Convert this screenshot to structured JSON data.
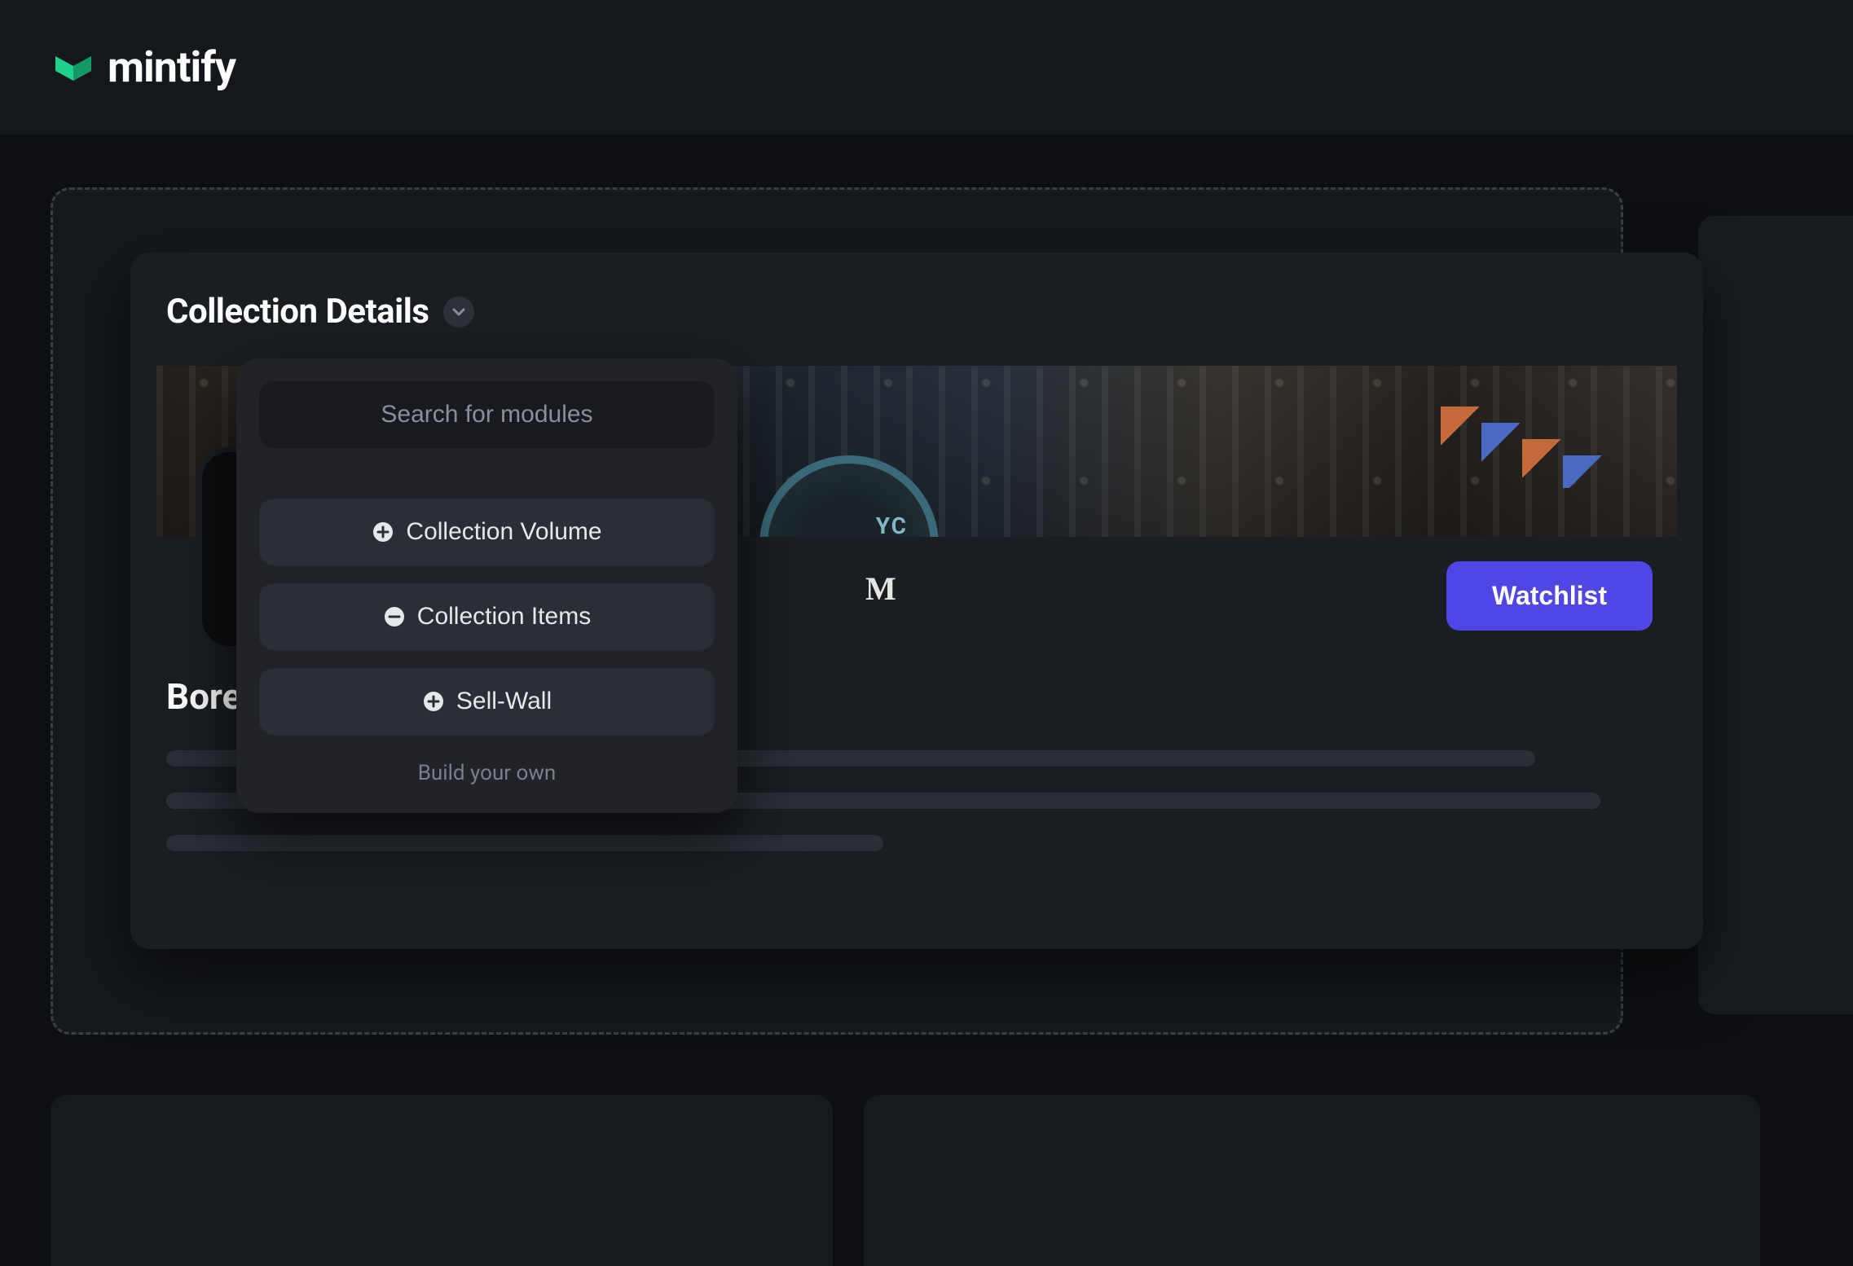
{
  "brand": {
    "name": "mintify",
    "accent": "#1fd28a"
  },
  "card": {
    "title": "Collection Details",
    "club_label_fragment": "M",
    "watchlist_label": "Watchlist",
    "collection_name_visible": "Bore"
  },
  "popover": {
    "search_placeholder": "Search for modules",
    "modules": [
      {
        "icon": "plus",
        "label": "Collection Volume"
      },
      {
        "icon": "minus",
        "label": "Collection Items"
      },
      {
        "icon": "plus",
        "label": "Sell-Wall"
      }
    ],
    "build_link": "Build your own"
  },
  "colors": {
    "primary_button": "#4f46e5",
    "card_bg": "#1a1d22",
    "popover_bg": "#212329"
  }
}
